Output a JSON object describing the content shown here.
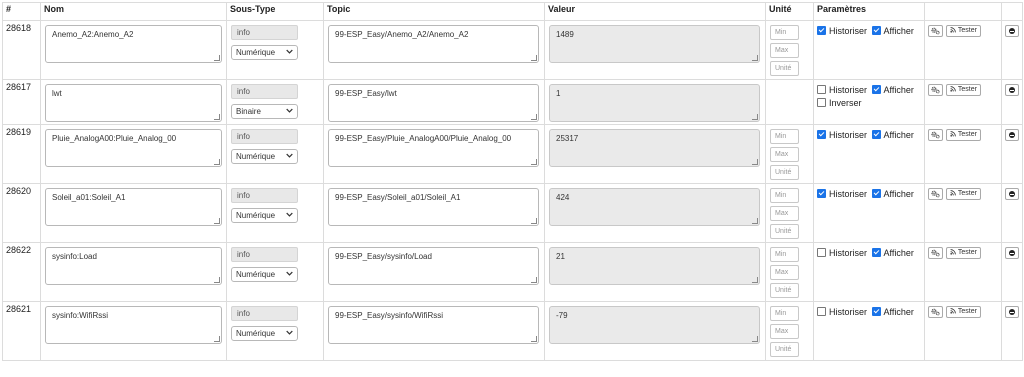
{
  "headers": {
    "id": "#",
    "name": "Nom",
    "subtype": "Sous-Type",
    "topic": "Topic",
    "value": "Valeur",
    "unit": "Unité",
    "params": "Paramètres"
  },
  "labels": {
    "historize": "Historiser",
    "display": "Afficher",
    "invert": "Inverser",
    "test": "Tester",
    "min_placeholder": "Min",
    "max_placeholder": "Max",
    "unit_placeholder": "Unité"
  },
  "icons": {
    "settings": "cogs-icon",
    "test": "rss-icon",
    "remove": "minus-circle-icon",
    "dropdown": "chevron-down-icon",
    "resize": "resize-grip-icon"
  },
  "colors": {
    "checkbox_checked": "#1a73e8",
    "readonly_field": "#eaeaea",
    "border": "#dcdcdc"
  },
  "rows": [
    {
      "id": "28618",
      "name": "Anemo_A2:Anemo_A2",
      "type": "info",
      "subtype": "Numérique",
      "topic": "99-ESP_Easy/Anemo_A2/Anemo_A2",
      "value": "1489",
      "historize": true,
      "display": true
    },
    {
      "id": "28617",
      "name": "lwt",
      "type": "info",
      "subtype": "Binaire",
      "topic": "99-ESP_Easy/lwt",
      "value": "1",
      "historize": false,
      "display": true,
      "invert": false
    },
    {
      "id": "28619",
      "name": "Pluie_AnalogA00:Pluie_Analog_00",
      "type": "info",
      "subtype": "Numérique",
      "topic": "99-ESP_Easy/Pluie_AnalogA00/Pluie_Analog_00",
      "value": "25317",
      "historize": true,
      "display": true
    },
    {
      "id": "28620",
      "name": "Soleil_a01:Soleil_A1",
      "type": "info",
      "subtype": "Numérique",
      "topic": "99-ESP_Easy/Soleil_a01/Soleil_A1",
      "value": "424",
      "historize": true,
      "display": true
    },
    {
      "id": "28622",
      "name": "sysinfo:Load",
      "type": "info",
      "subtype": "Numérique",
      "topic": "99-ESP_Easy/sysinfo/Load",
      "value": "21",
      "historize": false,
      "display": true
    },
    {
      "id": "28621",
      "name": "sysinfo:WifiRssi",
      "type": "info",
      "subtype": "Numérique",
      "topic": "99-ESP_Easy/sysinfo/WifiRssi",
      "value": "-79",
      "historize": false,
      "display": true
    }
  ]
}
